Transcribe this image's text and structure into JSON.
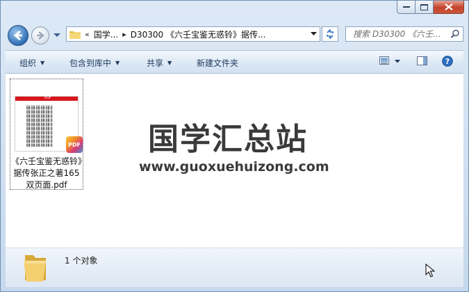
{
  "window": {
    "caption_buttons": {
      "minimize": "minimize",
      "maximize": "maximize",
      "close": "close"
    }
  },
  "address": {
    "overflow": "«",
    "crumbs": [
      "国学...",
      "D30300 《六壬宝鉴无惑铃》据传..."
    ],
    "separator": "▸"
  },
  "search": {
    "placeholder": "搜索 D30300 《六壬..."
  },
  "toolbar": {
    "organize": "组织",
    "include_in_library": "包含到库中",
    "share": "共享",
    "new_folder": "新建文件夹"
  },
  "files": [
    {
      "name": "《六壬宝鉴无惑铃》据传张正之著165双页面.pdf",
      "thumb_header": "PDF",
      "badge": "PDF"
    }
  ],
  "watermark": {
    "title": "国学汇总站",
    "url": "www.guoxuehuizong.com"
  },
  "details": {
    "count": "1 个对象"
  },
  "colors": {
    "toolbar_text": "#1e395b",
    "pdf_red": "#d8161c",
    "close_red": "#c4412b"
  }
}
